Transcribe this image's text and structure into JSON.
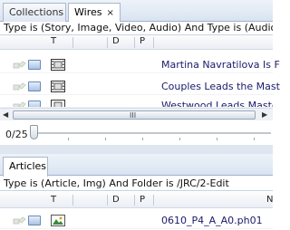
{
  "wires_panel": {
    "tabs": [
      {
        "label": "Collections"
      },
      {
        "label": "Wires",
        "close": "×"
      }
    ],
    "filter_text": "Type is (Story, Image, Video, Audio) And Type is (Audio,",
    "columns": {
      "type": "T",
      "d": "D",
      "p": "P"
    },
    "rows": [
      {
        "title": "Martina Navratilova Is F"
      },
      {
        "title": "Couples Leads the Mast"
      },
      {
        "title": "Westwood Leads Master"
      }
    ],
    "scroll_grip": "III",
    "pager": {
      "count": "0/25"
    }
  },
  "articles_panel": {
    "tabs": [
      {
        "label": "Articles"
      }
    ],
    "filter_text": "Type is (Article, Img) And Folder is /JRC/2-Edit",
    "columns": {
      "type": "T",
      "d": "D",
      "p": "P",
      "name": "N"
    },
    "rows": [
      {
        "title": "0610_P4_A_A0.ph01"
      }
    ]
  },
  "icons": {
    "ghost": "ghost-link-icon",
    "box": "checkout-box-icon",
    "video": "film-strip-icon",
    "image": "picture-icon"
  },
  "colors": {
    "tab_border": "#a9b8cc",
    "title_text": "#1a1a6a"
  }
}
